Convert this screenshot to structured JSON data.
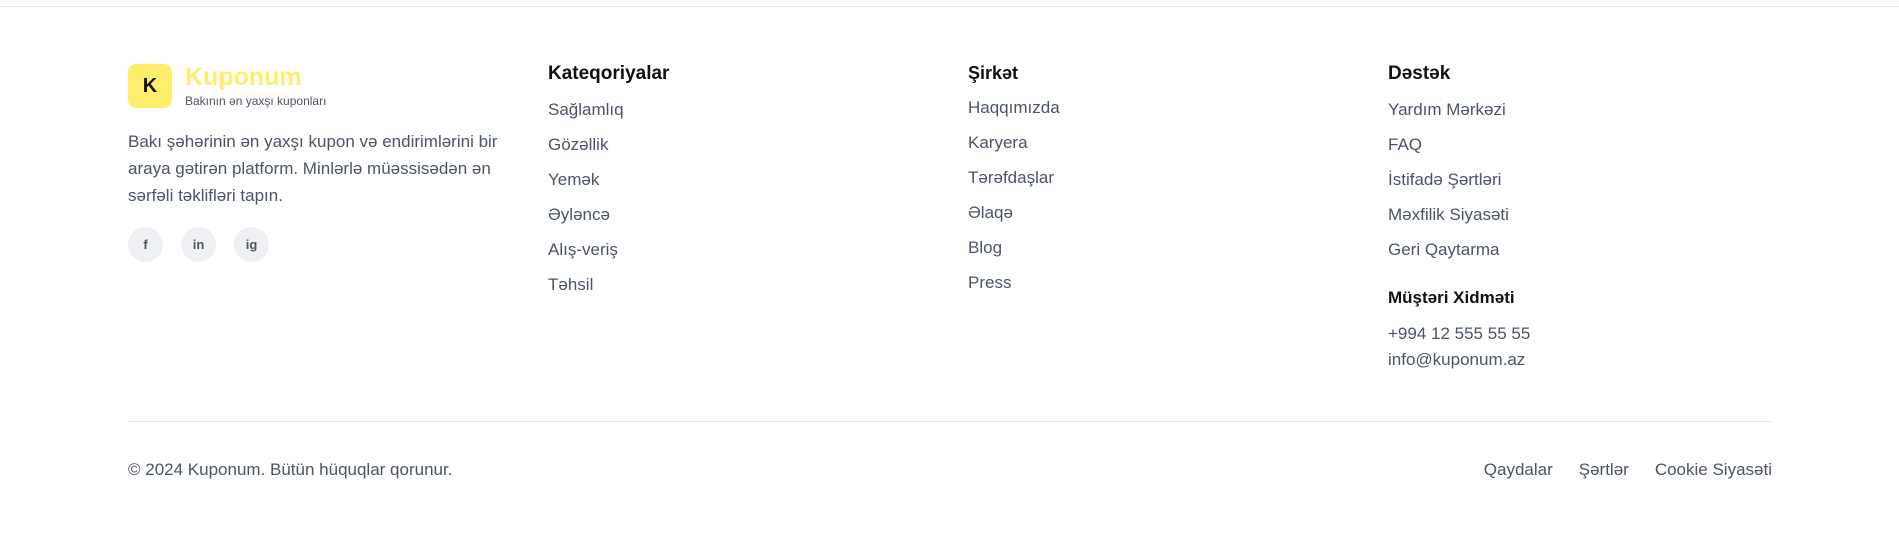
{
  "brand": {
    "logo_letter": "K",
    "name": "Kuponum",
    "tagline": "Bakının ən yaxşı kuponları",
    "description": "Bakı şəhərinin ən yaxşı kupon və endirimlərini bir araya gətirən platform. Minlərlə müəssisədən ən sərfəli təklifləri tapın.",
    "accent_color": "#fdef6c",
    "socials": [
      {
        "label": "f",
        "icon": "facebook-icon"
      },
      {
        "label": "in",
        "icon": "linkedin-icon"
      },
      {
        "label": "ig",
        "icon": "instagram-icon"
      }
    ]
  },
  "categories": {
    "title": "Kateqoriyalar",
    "items": [
      "Sağlamlıq",
      "Gözəllik",
      "Yemək",
      "Əyləncə",
      "Alış-veriş",
      "Təhsil"
    ]
  },
  "company": {
    "title": "Şirkət",
    "items": [
      "Haqqımızda",
      "Karyera",
      "Tərəfdaşlar",
      "Əlaqə",
      "Blog",
      "Press"
    ]
  },
  "support": {
    "title": "Dəstək",
    "items": [
      "Yardım Mərkəzi",
      "FAQ",
      "İstifadə Şərtləri",
      "Məxfilik Siyasəti",
      "Geri Qaytarma"
    ],
    "customer_service_title": "Müştəri Xidməti",
    "phone": "+994 12 555 55 55",
    "email": "info@kuponum.az"
  },
  "bottom": {
    "copyright": "© 2024 Kuponum. Bütün hüquqlar qorunur.",
    "links": [
      "Qaydalar",
      "Şərtlər",
      "Cookie Siyasəti"
    ]
  }
}
